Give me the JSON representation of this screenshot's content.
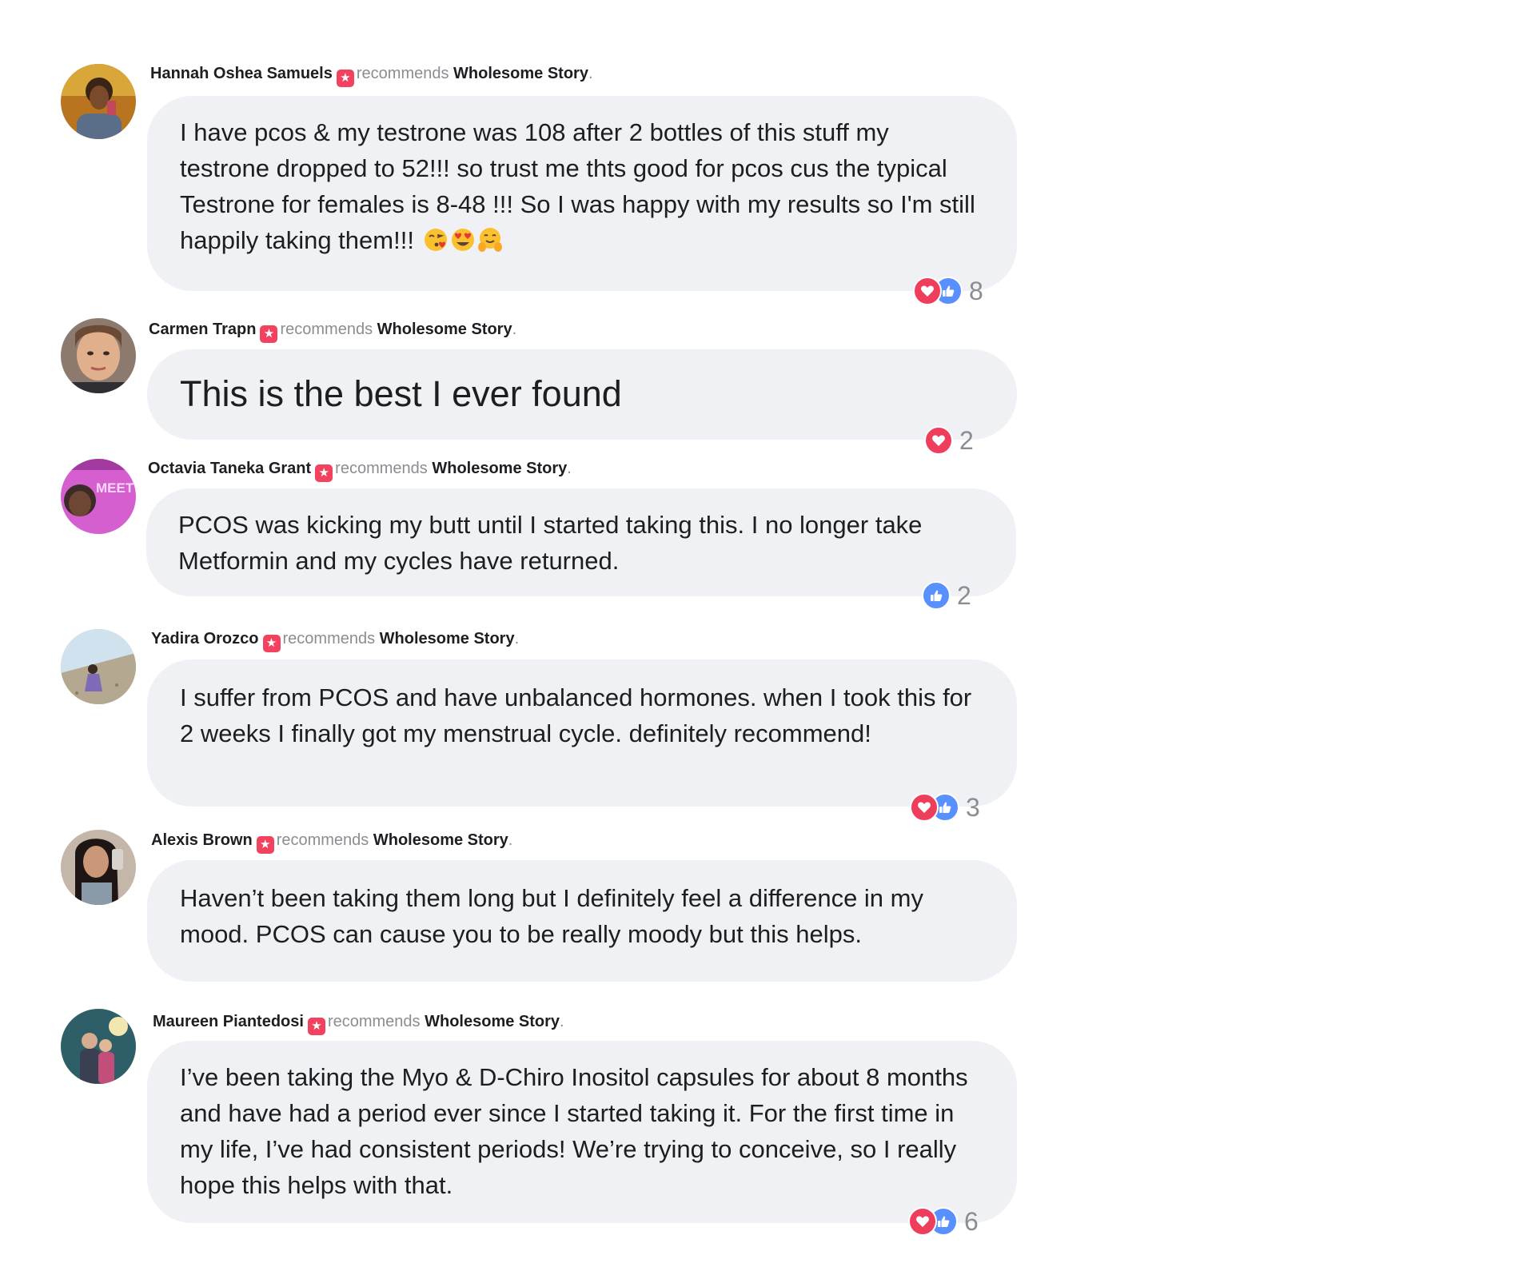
{
  "reviews": [
    {
      "author": "Hannah Oshea Samuels",
      "verb": "recommends",
      "page": "Wholesome Story",
      "text": "I have pcos & my testrone was 108 after 2 bottles of this stuff my testrone dropped to 52!!! so trust me thts good for pcos cus the typical Testrone for females is 8-48 !!! So I was happy with my results so I'm still happily taking them!!!",
      "emojis": [
        "kissing-face-emoji",
        "heart-eyes-emoji",
        "hugging-face-emoji"
      ],
      "reactions": [
        "love",
        "like"
      ],
      "count": "8"
    },
    {
      "author": "Carmen Trapn",
      "verb": "recommends",
      "page": "Wholesome Story",
      "text": "This is the best I ever found",
      "reactions": [
        "love"
      ],
      "count": "2"
    },
    {
      "author": "Octavia Taneka Grant",
      "verb": "recommends",
      "page": "Wholesome Story",
      "text": "PCOS was kicking my butt until I started taking this. I no longer take Metformin and my cycles have returned.",
      "avatar_text": "MEET ME THERE!",
      "reactions": [
        "like"
      ],
      "count": "2"
    },
    {
      "author": "Yadira Orozco",
      "verb": "recommends",
      "page": "Wholesome Story",
      "text": "I suffer from PCOS and have unbalanced hormones. when I took this for 2 weeks I finally got my menstrual cycle. definitely recommend!",
      "reactions": [
        "love",
        "like"
      ],
      "count": "3"
    },
    {
      "author": "Alexis Brown",
      "verb": "recommends",
      "page": "Wholesome Story",
      "text": "Haven’t been taking them long but I definitely feel a difference in my mood. PCOS can cause you to be really moody but this helps."
    },
    {
      "author": "Maureen Piantedosi",
      "verb": "recommends",
      "page": "Wholesome Story",
      "text": "I’ve been taking the Myo & D-Chiro Inositol capsules for about 8 months and have had a period ever since I started taking it. For the first time in my life, I’ve had consistent periods! We’re trying to conceive, so I really hope this helps with that.",
      "reactions": [
        "love",
        "like"
      ],
      "count": "6"
    }
  ],
  "colors": {
    "bubble": "#f0f1f5",
    "love": "#ef3e5c",
    "like": "#5890ff",
    "badge": "#f3425f",
    "muted": "#8a8d91"
  }
}
